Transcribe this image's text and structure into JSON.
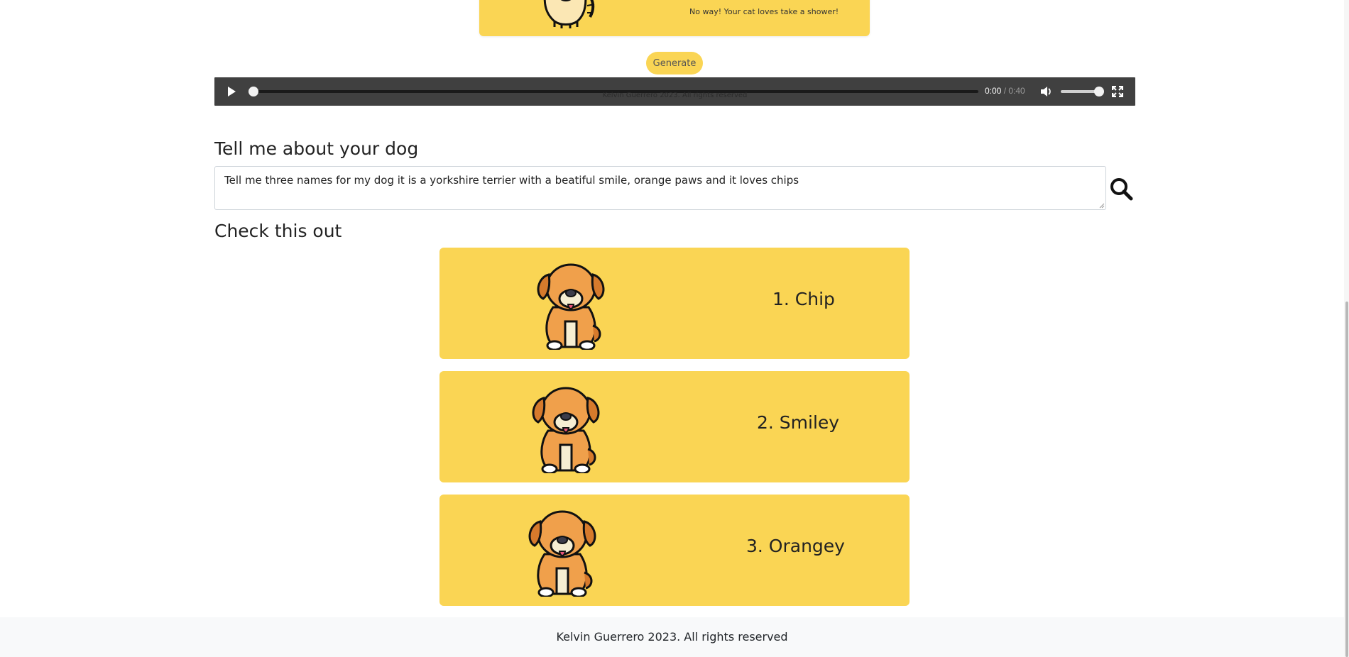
{
  "cat_card": {
    "text": "No way! Your cat loves take a shower!",
    "image": "cat-illustration"
  },
  "generate_label": "Generate",
  "player": {
    "current_time": "0:00",
    "separator": " / ",
    "total_time": "0:40",
    "overlay_text": "Kelvin Guerrero 2023. All rights reserved",
    "progress": 0,
    "volume": 0.85,
    "icons": [
      "play-icon",
      "volume-icon",
      "fullscreen-icon"
    ]
  },
  "dog_section": {
    "title": "Tell me about your dog",
    "prompt_value": "Tell me three names for my dog it is a yorkshire terrier with a beatiful smile, orange paws and it loves chips"
  },
  "results": {
    "title": "Check this out",
    "items": [
      {
        "name": "1. Chip"
      },
      {
        "name": "2. Smiley"
      },
      {
        "name": "3. Orangey"
      }
    ]
  },
  "footer": {
    "text": "Kelvin Guerrero 2023. All rights reserved"
  },
  "colors": {
    "card": "#fad554",
    "player": "#404040",
    "footer": "#f8f9fa"
  }
}
